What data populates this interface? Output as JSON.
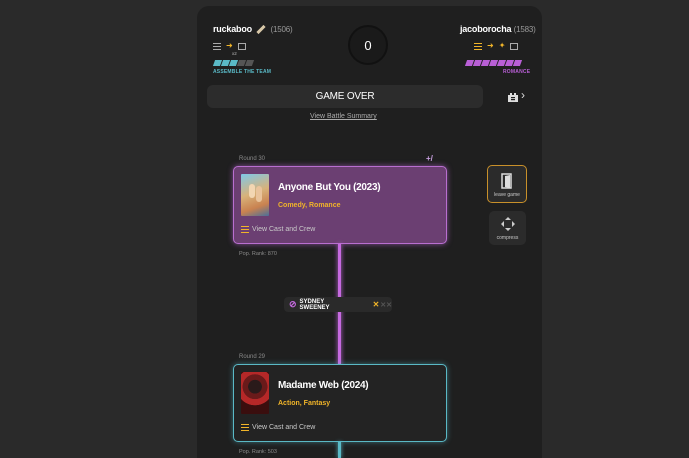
{
  "header": {
    "player1": {
      "name": "ruckaboo",
      "rank": "(1506)",
      "wildcard": "x2",
      "team_label": "ASSEMBLE THE TEAM"
    },
    "player2": {
      "name": "jacoborocha",
      "rank": "(1583)",
      "team_label": "ROMANCE"
    },
    "timer": "0"
  },
  "status": {
    "game_over": "GAME OVER",
    "battle_summary": "View Battle Summary"
  },
  "sidebar": {
    "leave_label": "leave game",
    "compress_label": "compress"
  },
  "rounds": [
    {
      "round": "Round 30",
      "title": "Anyone But You (2023)",
      "genres": "Comedy, Romance",
      "cast_link": "View Cast and Crew",
      "pop_rank": "Pop. Rank:  870",
      "corner_icons": "+/"
    },
    {
      "round": "Round 29",
      "title": "Madame Web (2024)",
      "genres": "Action, Fantasy",
      "cast_link": "View Cast and Crew",
      "pop_rank": "Pop. Rank:  503"
    }
  ],
  "connection": {
    "name": "SYDNEY SWEENEY",
    "strikes": "✕"
  },
  "colors": {
    "player1": "#5ab9c6",
    "player2": "#b95fd6",
    "accent": "#f0b429",
    "purple_card": "#6b3f72",
    "line": "#c66ae0"
  },
  "icon_names": [
    "list-icon",
    "arrow-icon",
    "calendar-icon",
    "sword-icon",
    "crown-icon",
    "castle-icon",
    "chevron-right-icon",
    "link-icon",
    "door-icon",
    "compress-icon"
  ]
}
